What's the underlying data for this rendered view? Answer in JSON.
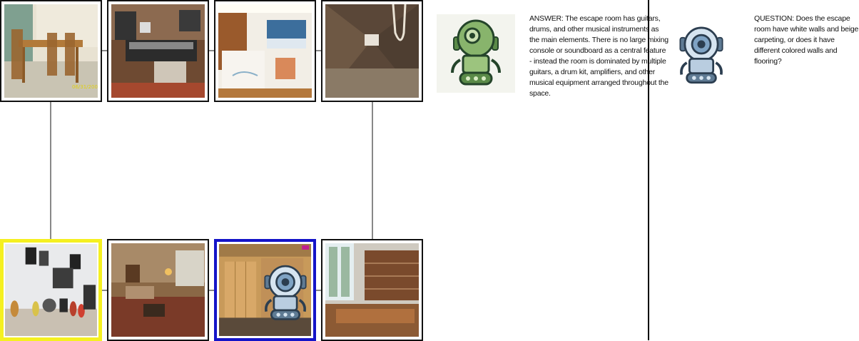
{
  "grid": {
    "tiles": [
      {
        "name": "tile-dining-room",
        "scene": "dining room",
        "date_stamp": "06/31/2005"
      },
      {
        "name": "tile-recording-studio",
        "scene": "recording studio"
      },
      {
        "name": "tile-reception",
        "scene": "reception area"
      },
      {
        "name": "tile-attic",
        "scene": "attic"
      },
      {
        "name": "tile-music-room",
        "scene": "music room",
        "selected": "yellow"
      },
      {
        "name": "tile-living-room",
        "scene": "living room"
      },
      {
        "name": "tile-locker-room",
        "scene": "locker room",
        "selected": "blue"
      },
      {
        "name": "tile-library",
        "scene": "library"
      }
    ],
    "colors": {
      "selected_yellow": "#f5f020",
      "selected_blue": "#1414c8",
      "connector": "#888888"
    }
  },
  "answerer": {
    "avatar_icon": "green-robot-icon",
    "text": "ANSWER: The escape room has guitars, drums, and other musical instruments as the main elements. There is no large mixing console or soundboard as a central feature - instead the room is dominated by multiple guitars, a drum kit, amplifiers, and other musical equipment arranged throughout the space."
  },
  "questioner": {
    "avatar_icon": "blue-robot-icon",
    "text": "QUESTION: Does the escape room have white walls and beige carpeting, or does it have different colored walls and flooring?"
  }
}
